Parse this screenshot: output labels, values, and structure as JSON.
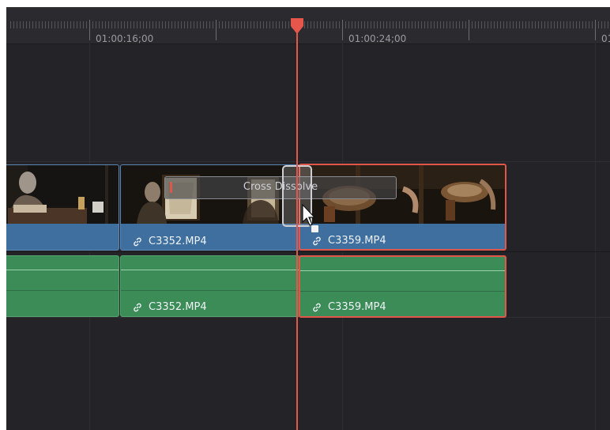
{
  "ruler": {
    "timecodes": [
      "01:00:16;00",
      "01:00:24;00",
      "01"
    ]
  },
  "transition": {
    "label": "Cross Dissolve"
  },
  "video_track": {
    "clips": [
      {
        "name": "",
        "selected": false
      },
      {
        "name": "C3352.MP4",
        "selected": false
      },
      {
        "name": "C3359.MP4",
        "selected": true
      }
    ]
  },
  "audio_track": {
    "clips": [
      {
        "name": "",
        "selected": false
      },
      {
        "name": "C3352.MP4",
        "selected": false
      },
      {
        "name": "C3359.MP4",
        "selected": true
      }
    ]
  },
  "colors": {
    "video_clip": "#3f6f9e",
    "audio_clip": "#3c8c58",
    "playhead": "#e6564a",
    "selection": "#e0574a",
    "background": "#242428"
  },
  "icons": [
    "link-icon",
    "playhead-marker",
    "mouse-pointer-icon",
    "transition-badge-icon"
  ]
}
